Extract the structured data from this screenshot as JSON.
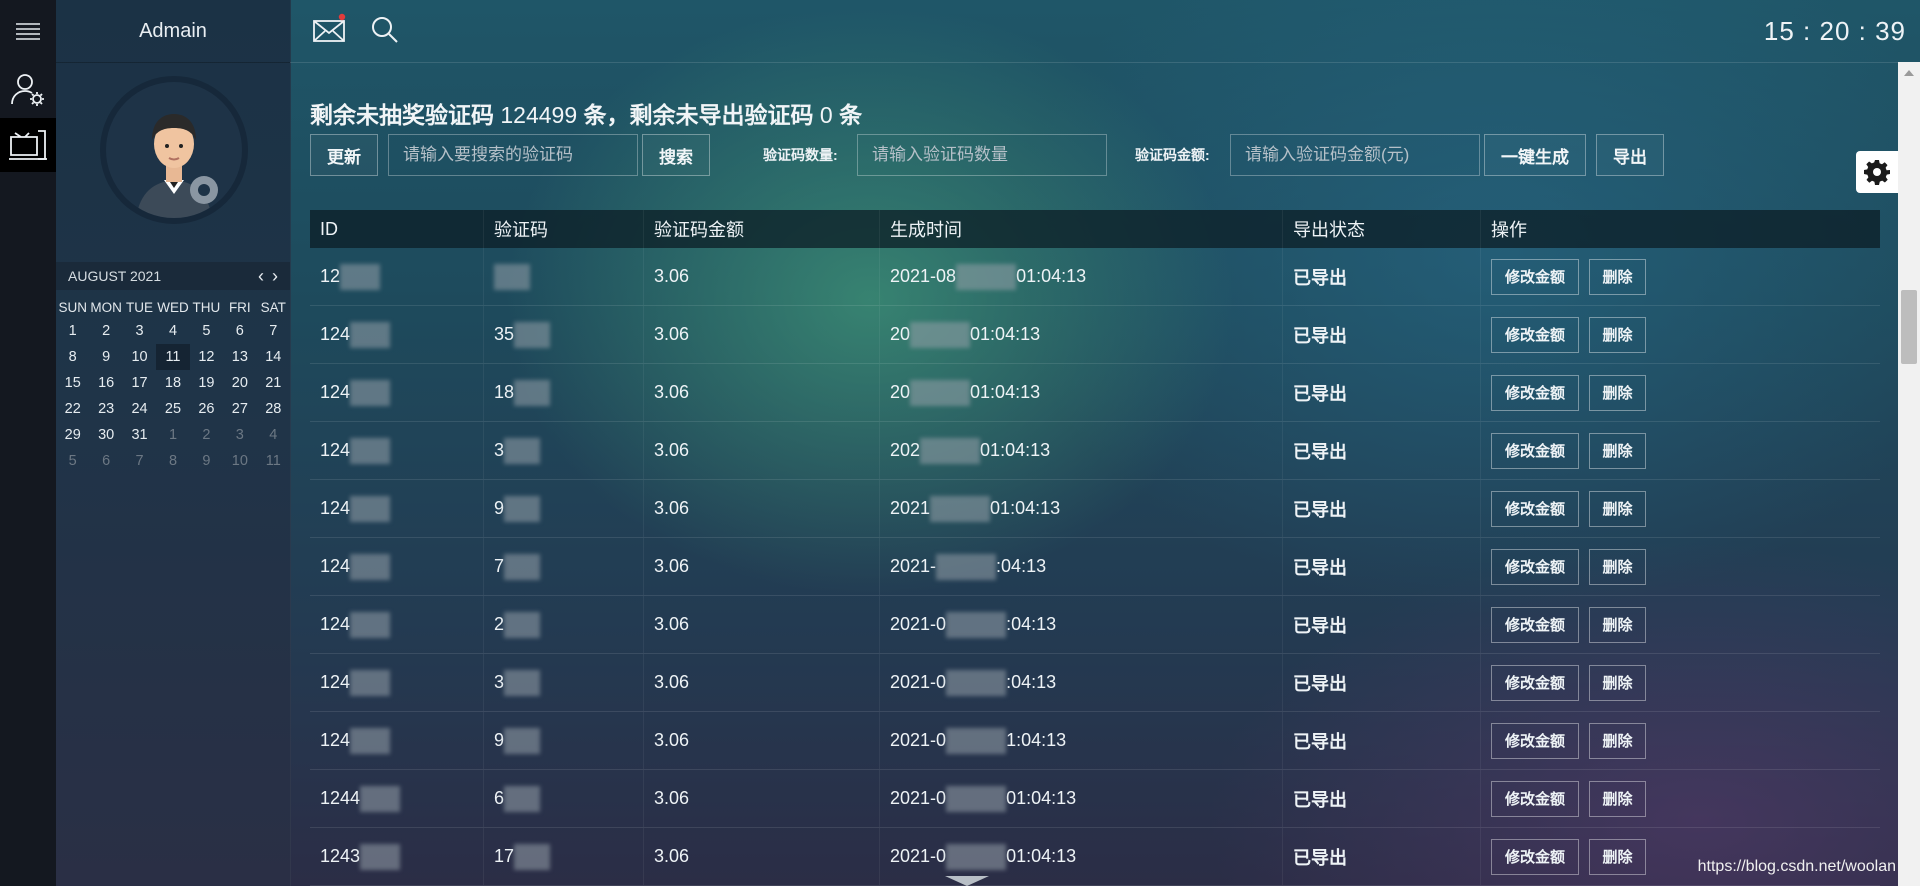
{
  "sidebar": {
    "brand": "Admain",
    "calendar": {
      "month_label": "AUGUST 2021",
      "weekdays": [
        "SUN",
        "MON",
        "TUE",
        "WED",
        "THU",
        "FRI",
        "SAT"
      ],
      "weeks": [
        [
          "1",
          "2",
          "3",
          "4",
          "5",
          "6",
          "7"
        ],
        [
          "8",
          "9",
          "10",
          "11",
          "12",
          "13",
          "14"
        ],
        [
          "15",
          "16",
          "17",
          "18",
          "19",
          "20",
          "21"
        ],
        [
          "22",
          "23",
          "24",
          "25",
          "26",
          "27",
          "28"
        ],
        [
          "29",
          "30",
          "31",
          "1",
          "2",
          "3",
          "4"
        ],
        [
          "5",
          "6",
          "7",
          "8",
          "9",
          "10",
          "11"
        ]
      ],
      "selected_day": "11"
    }
  },
  "topbar": {
    "clock": "15 : 20 : 39"
  },
  "summary": {
    "prefix": "剩余未抽奖验证码",
    "count1": " 124499 ",
    "mid": "条，剩余未导出验证码",
    "count2": " 0 ",
    "suffix": "条"
  },
  "toolbar": {
    "refresh_label": "更新",
    "search_placeholder": "请输入要搜索的验证码",
    "search_label": "搜索",
    "qty_label": "验证码数量:",
    "qty_placeholder": "请输入验证码数量",
    "amount_label": "验证码金额:",
    "amount_placeholder": "请输入验证码金额(元)",
    "generate_label": "一键生成",
    "export_label": "导出"
  },
  "table": {
    "headers": [
      "ID",
      "验证码",
      "验证码金额",
      "生成时间",
      "导出状态",
      "操作"
    ],
    "edit_label": "修改金额",
    "delete_label": "删除",
    "rows": [
      {
        "id": "12",
        "code": "",
        "amount": "3.06",
        "time_a": "2021-08",
        "time_b": "01:04:13",
        "status": "已导出"
      },
      {
        "id": "124",
        "code": "35",
        "amount": "3.06",
        "time_a": "20",
        "time_b": "01:04:13",
        "status": "已导出"
      },
      {
        "id": "124",
        "code": "18",
        "amount": "3.06",
        "time_a": "20",
        "time_b": "01:04:13",
        "status": "已导出"
      },
      {
        "id": "124",
        "code": "3",
        "amount": "3.06",
        "time_a": "202",
        "time_b": "01:04:13",
        "status": "已导出"
      },
      {
        "id": "124",
        "code": "9",
        "amount": "3.06",
        "time_a": "2021",
        "time_b": "01:04:13",
        "status": "已导出"
      },
      {
        "id": "124",
        "code": "7",
        "amount": "3.06",
        "time_a": "2021-",
        "time_b": ":04:13",
        "status": "已导出"
      },
      {
        "id": "124",
        "code": "2",
        "amount": "3.06",
        "time_a": "2021-0",
        "time_b": ":04:13",
        "status": "已导出"
      },
      {
        "id": "124",
        "code": "3",
        "amount": "3.06",
        "time_a": "2021-0",
        "time_b": ":04:13",
        "status": "已导出"
      },
      {
        "id": "124",
        "code": "9",
        "amount": "3.06",
        "time_a": "2021-0",
        "time_b": "1:04:13",
        "status": "已导出"
      },
      {
        "id": "1244",
        "code": "6",
        "amount": "3.06",
        "time_a": "2021-0",
        "time_b": "01:04:13",
        "status": "已导出"
      },
      {
        "id": "1243",
        "code": "17",
        "amount": "3.06",
        "time_a": "2021-0",
        "time_b": "01:04:13",
        "status": "已导出"
      }
    ]
  },
  "watermark": "https://blog.csdn.net/woolan",
  "colors": {
    "rail_bg": "#141820",
    "selected_tool_bg": "#000000",
    "sidebar_bg": "#1f3448"
  }
}
